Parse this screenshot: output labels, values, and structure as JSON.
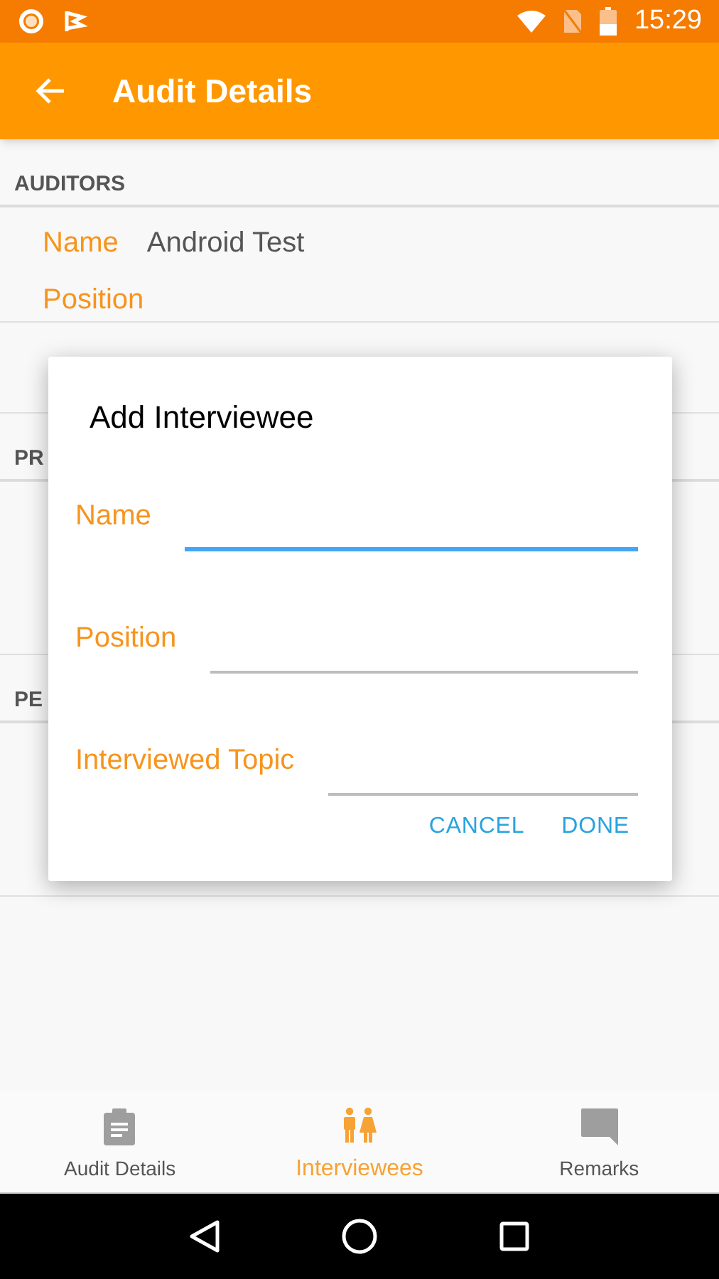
{
  "status_bar": {
    "time": "15:29"
  },
  "app_bar": {
    "title": "Audit Details"
  },
  "sections": [
    {
      "header": "AUDITORS",
      "fields": [
        {
          "label": "Name",
          "value": "Android Test"
        },
        {
          "label": "Position"
        }
      ]
    },
    {
      "header": "PR"
    },
    {
      "header": "PE"
    }
  ],
  "dialog": {
    "title": "Add Interviewee",
    "fields": [
      {
        "label": "Name",
        "focused": true
      },
      {
        "label": "Position",
        "focused": false
      },
      {
        "label": "Interviewed Topic",
        "focused": false
      }
    ],
    "buttons": [
      "CANCEL",
      "DONE"
    ]
  },
  "bottom_nav": [
    {
      "label": "Audit Details",
      "kind": "clipboard",
      "selected": false
    },
    {
      "label": "Interviewees",
      "kind": "people",
      "selected": true
    },
    {
      "label": "Remarks",
      "kind": "chat",
      "selected": false
    }
  ]
}
